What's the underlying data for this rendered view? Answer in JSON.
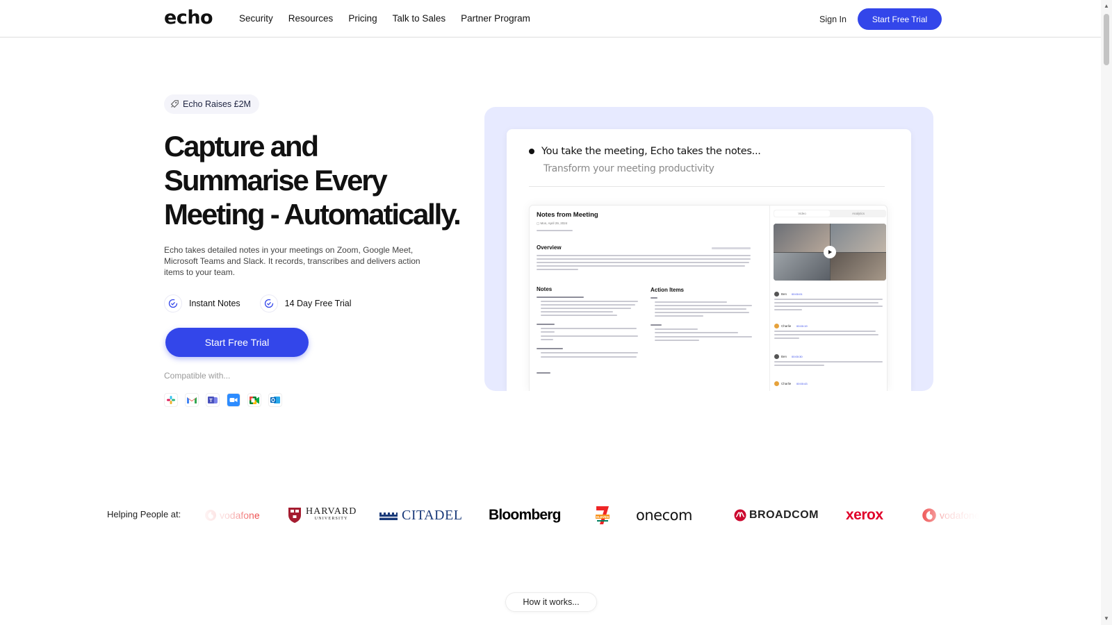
{
  "nav": {
    "logo": "echo",
    "links": [
      "Security",
      "Resources",
      "Pricing",
      "Talk to Sales",
      "Partner Program"
    ],
    "sign_in": "Sign In",
    "cta": "Start Free Trial"
  },
  "hero": {
    "badge": "Echo Raises £2M",
    "title": "Capture and Summarise Every Meeting - Automatically.",
    "description": "Echo takes detailed notes in your meetings on Zoom, Google Meet, Microsoft Teams and Slack. It records, transcribes and delivers action items to your team.",
    "features": [
      "Instant Notes",
      "14 Day Free Trial"
    ],
    "cta": "Start Free Trial",
    "compatible": "Compatible with...",
    "apps": [
      "slack-icon",
      "gmail-icon",
      "teams-icon",
      "zoom-icon",
      "google-meet-icon",
      "outlook-icon"
    ]
  },
  "demo": {
    "headline": "You take the meeting, Echo takes the notes...",
    "subline": "Transform your meeting productivity",
    "notes_title": "Notes from Meeting",
    "date": "Mon, April 29, 2024",
    "overview": "Overview",
    "notes": "Notes",
    "action_items": "Action Items",
    "tabs": [
      "Video",
      "Analytics"
    ],
    "chat": [
      {
        "name": "Ben",
        "time": "00:00:01"
      },
      {
        "name": "Charlie",
        "time": "00:00:19"
      },
      {
        "name": "Ben",
        "time": "00:00:30"
      },
      {
        "name": "Charlie",
        "time": "00:00:43"
      }
    ]
  },
  "logos": {
    "label": "Helping People at:",
    "brands": [
      "vodafone",
      "HARVARD",
      "CITADEL",
      "Bloomberg",
      "ELEVEN",
      "onecom",
      "BROADCOM",
      "xerox",
      "vodafone"
    ],
    "harvard_sub": "UNIVERSITY"
  },
  "how_it_works": "How it works...",
  "colors": {
    "accent": "#3346ea",
    "demo_bg": "#e7eaff"
  }
}
